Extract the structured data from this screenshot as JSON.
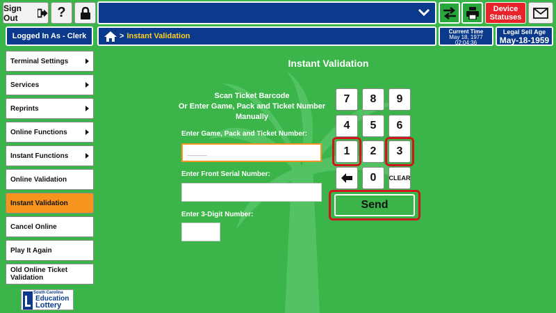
{
  "header": {
    "sign_out": "Sign Out",
    "help": "?",
    "device_statuses": "Device Statuses"
  },
  "status": {
    "logged_in": "Logged In As - Clerk",
    "breadcrumb": "Instant Validation",
    "current_time_label": "Current Time",
    "current_date": "May 18, 1977",
    "current_clock": "02:04:36",
    "legal_sell_age_label": "Legal Sell Age",
    "legal_sell_age_date": "May-18-1959"
  },
  "sidebar": {
    "items": [
      {
        "label": "Terminal Settings",
        "has_arrow": true
      },
      {
        "label": "Services",
        "has_arrow": true
      },
      {
        "label": "Reprints",
        "has_arrow": true
      },
      {
        "label": "Online Functions",
        "has_arrow": true
      },
      {
        "label": "Instant Functions",
        "has_arrow": true
      },
      {
        "label": "Online Validation",
        "has_arrow": false
      },
      {
        "label": "Instant Validation",
        "has_arrow": false,
        "active": true
      },
      {
        "label": "Cancel Online",
        "has_arrow": false
      },
      {
        "label": "Play It Again",
        "has_arrow": false
      },
      {
        "label": "Old Online Ticket Validation",
        "has_arrow": false
      }
    ]
  },
  "logo": {
    "line1": "South Carolina",
    "line2": "Education",
    "line3": "Lottery"
  },
  "main": {
    "title": "Instant Validation",
    "scan_line1": "Scan Ticket Barcode",
    "scan_line2": "Or Enter Game, Pack and Ticket Number",
    "scan_line3": "Manually",
    "game_label": "Enter Game, Pack and Ticket Number:",
    "game_placeholder": "____",
    "serial_label": "Enter Front Serial Number:",
    "digit_label": "Enter 3-Digit Number:"
  },
  "keypad": {
    "keys": [
      "7",
      "8",
      "9",
      "4",
      "5",
      "6",
      "1",
      "2",
      "3",
      "0"
    ],
    "clear": "CLEAR",
    "send": "Send"
  },
  "colors": {
    "background": "#3bb54a",
    "navy": "#0b3a8c",
    "accent_orange": "#f7941d",
    "alert_red": "#e8232b",
    "highlight_ring": "#d0161c",
    "breadcrumb_text": "#ffd21f"
  }
}
